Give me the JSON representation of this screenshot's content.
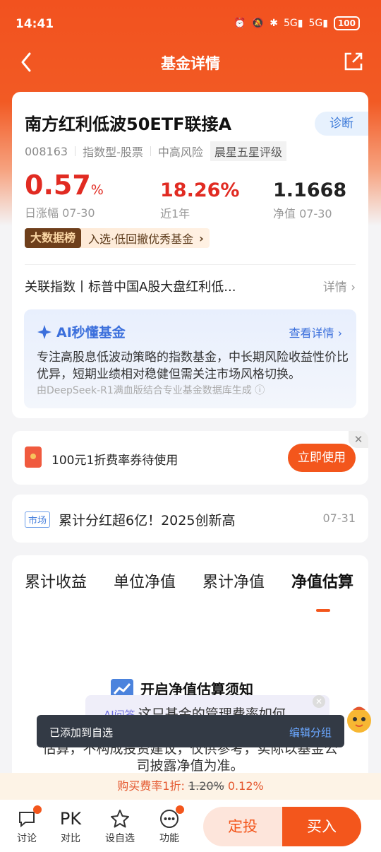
{
  "status": {
    "time": "14:41",
    "battery": "100",
    "net1": "5G",
    "net2": "5G"
  },
  "nav": {
    "title": "基金详情"
  },
  "fund": {
    "name": "南方红利低波50ETF联接A",
    "diagnose": "诊断",
    "code": "008163",
    "type": "指数型-股票",
    "risk": "中高风险",
    "rating": "晨星五星评级",
    "daily_change": "0.57",
    "daily_change_unit": "%",
    "daily_label": "日涨幅 07-30",
    "year_return": "18.26%",
    "year_label": "近1年",
    "nav_value": "1.1668",
    "nav_label": "净值 07-30",
    "banner_badge": "大数据榜",
    "banner_text": "入选·低回撤优秀基金",
    "related_index": "关联指数丨标普中国A股大盘红利低...",
    "related_more": "详情",
    "ai_title": "AI秒懂基金",
    "ai_more": "查看详情",
    "ai_text": "专注高股息低波动策略的指数基金，中长期风险收益性价比优异，短期业绩相对稳健但需关注市场风格切换。",
    "ai_source": "由DeepSeek-R1满血版结合专业基金数据库生成"
  },
  "coupon": {
    "text": "100元1折费率券待使用",
    "button": "立即使用"
  },
  "news": {
    "tag": "市场",
    "text": "累计分红超6亿！2025创新高",
    "date": "07-31"
  },
  "tabs": [
    "累计收益",
    "单位净值",
    "累计净值",
    "净值估算"
  ],
  "estimate": {
    "title": "开启净值估算须知",
    "aiq_tag": "AI问答",
    "aiq_text": "这只基金的管理费率如何",
    "disclaimer": "估算，不构成投资建议，仅供参考，实际以基金公司披露净值为准。"
  },
  "toast": {
    "message": "已添加到自选",
    "action": "编辑分组"
  },
  "fee": {
    "label": "购买费率1折:",
    "old": "1.20%",
    "new": "0.12%"
  },
  "bottom": {
    "discuss": "讨论",
    "pk_icon": "PK",
    "compare": "对比",
    "watchlist": "设自选",
    "more": "功能",
    "dingtou": "定投",
    "buy": "买入"
  },
  "colors": {
    "brand": "#f3561c",
    "up": "#e12b22",
    "ai": "#3b6fdc"
  }
}
